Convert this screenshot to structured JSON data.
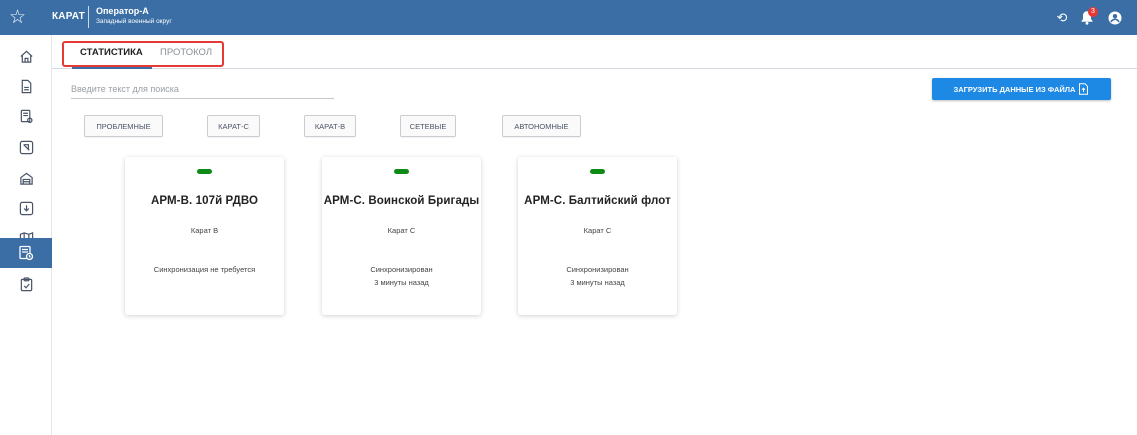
{
  "header": {
    "brand": "КАРАТ",
    "user_name": "Оператор-А",
    "user_subtitle": "Западный военный округ",
    "notification_count": "3"
  },
  "tabs": [
    "СТАТИСТИКА",
    "ПРОТОКОЛ"
  ],
  "active_tab": "СТАТИСТИКА",
  "search": {
    "placeholder": "Введите текст для поиска"
  },
  "upload_button": "ЗАГРУЗИТЬ ДАННЫЕ ИЗ ФАЙЛА",
  "filters": [
    "ПРОБЛЕМНЫЕ",
    "КАРАТ-С",
    "КАРАТ-В",
    "СЕТЕВЫЕ",
    "АВТОНОМНЫЕ"
  ],
  "cards": [
    {
      "title": "АРМ-В. 107й РДВО",
      "type": "Карат В",
      "sync_status": "Синхронизация не требуется",
      "sync_time": "",
      "status_color": "#0e8a16"
    },
    {
      "title": "АРМ-С. Воинской Бригады",
      "type": "Карат С",
      "sync_status": "Синхронизирован",
      "sync_time": "3 минуты назад",
      "status_color": "#0e8a16"
    },
    {
      "title": "АРМ-С. Балтийский флот",
      "type": "Карат С",
      "sync_status": "Синхронизирован",
      "sync_time": "3 минуты назад",
      "status_color": "#0e8a16"
    }
  ],
  "sidebar_icons": [
    "home-icon",
    "document-icon",
    "report-icon",
    "pointer-icon",
    "building-icon",
    "download-icon",
    "map-icon",
    "statistics-icon",
    "clipboard-icon"
  ],
  "colors": {
    "header": "#3a6ea5",
    "accent": "#1e88e5",
    "status_ok": "#0e8a16",
    "highlight": "#e53935"
  }
}
